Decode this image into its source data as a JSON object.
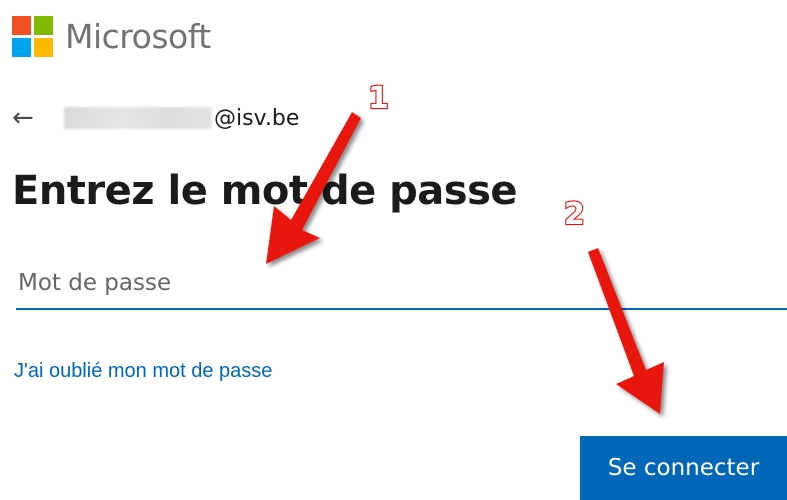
{
  "logo": {
    "text": "Microsoft",
    "colors": [
      "#f25022",
      "#7fba00",
      "#00a4ef",
      "#ffb900"
    ]
  },
  "identity": {
    "back_icon": "left-arrow-icon",
    "email_suffix": "@isv.be"
  },
  "title": "Entrez le mot de passe",
  "password": {
    "placeholder": "Mot de passe",
    "value": ""
  },
  "forgot_link": "J'ai oublié mon mot de passe",
  "signin_button": "Se connecter",
  "annotations": {
    "color": "#e8140e",
    "steps": [
      {
        "number": "1"
      },
      {
        "number": "2"
      }
    ]
  },
  "colors": {
    "accent": "#0067b8",
    "text": "#1b1b1b",
    "logo_text": "#737373"
  }
}
